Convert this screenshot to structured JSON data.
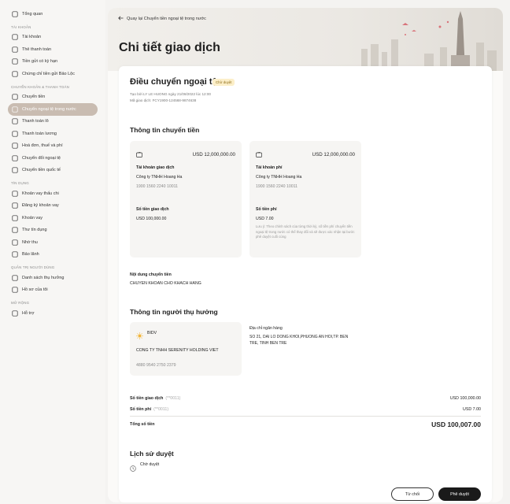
{
  "sidebar": {
    "top": [
      {
        "label": "Tổng quan",
        "icon": "dashboard-icon"
      }
    ],
    "groups": [
      {
        "heading": "TÀI KHOẢN",
        "items": [
          {
            "label": "Tài khoản",
            "icon": "bank-icon"
          },
          {
            "label": "Thẻ thanh toán",
            "icon": "card-icon"
          },
          {
            "label": "Tiền gửi có kỳ hạn",
            "icon": "deposit-icon"
          },
          {
            "label": "Chứng chỉ tiền gửi Bảo Lộc",
            "icon": "certificate-icon"
          }
        ]
      },
      {
        "heading": "CHUYỂN KHOẢN & THANH TOÁN",
        "items": [
          {
            "label": "Chuyển tiền",
            "icon": "transfer-icon"
          },
          {
            "label": "Chuyển ngoại tệ trong nước",
            "icon": "foreign-transfer-icon",
            "active": true
          },
          {
            "label": "Thanh toán lô",
            "icon": "batch-icon"
          },
          {
            "label": "Thanh toán lương",
            "icon": "payroll-icon"
          },
          {
            "label": "Hoá đơn, thuế và phí",
            "icon": "bill-icon"
          },
          {
            "label": "Chuyển đổi ngoại tệ",
            "icon": "exchange-icon"
          },
          {
            "label": "Chuyển tiền quốc tế",
            "icon": "globe-icon"
          }
        ]
      },
      {
        "heading": "TÍN DỤNG",
        "items": [
          {
            "label": "Khoản vay thấu chi",
            "icon": "overdraft-icon"
          },
          {
            "label": "Đăng ký khoản vay",
            "icon": "loan-register-icon"
          },
          {
            "label": "Khoản vay",
            "icon": "loan-icon"
          },
          {
            "label": "Thư tín dụng",
            "icon": "letter-credit-icon"
          },
          {
            "label": "Nhờ thu",
            "icon": "collection-icon"
          },
          {
            "label": "Bảo lãnh",
            "icon": "guarantee-icon"
          }
        ]
      },
      {
        "heading": "QUẢN TRỊ NGƯỜI DÙNG",
        "items": [
          {
            "label": "Danh sách thụ hưởng",
            "icon": "beneficiary-icon"
          },
          {
            "label": "Hồ sơ của tôi",
            "icon": "profile-icon"
          }
        ]
      },
      {
        "heading": "MỞ RỘNG",
        "items": [
          {
            "label": "Hỗ trợ",
            "icon": "help-icon"
          }
        ]
      }
    ]
  },
  "header": {
    "back_label": "Quay lại Chuyển tiền ngoại tệ trong nước",
    "page_title": "Chi tiết giao dịch"
  },
  "transaction": {
    "title": "Điều chuyển ngoại tệ",
    "status": "Chờ duyệt",
    "created_by": "Tạo bởi LY LE HUONG ngày 21/08/2022 lúc 12:00",
    "transaction_code": "Mã giao dịch: FCY1900-124568-9874638"
  },
  "transfer_info": {
    "heading": "Thông tin chuyển tiền",
    "source": {
      "balance": "USD 12,000,000.00",
      "account_label": "Tài khoản giao dịch",
      "company": "Công ty TNHH Hoang Ha",
      "account_number": "1900 1560 2240 10011",
      "amount_label": "Số tiền giao dịch",
      "amount": "USD 100,000.00"
    },
    "fee": {
      "balance": "USD 12,000,000.00",
      "account_label": "Tài khoản phí",
      "company": "Công ty TNHH Hoang Ha",
      "account_number": "1900 1560 2240 10011",
      "amount_label": "Số tiền phí",
      "amount": "USD 7.00",
      "note": "Lưu ý: Theo chính sách của từng thời kỳ, số tiền phí chuyển tiền ngoại tệ trong nước có thể thay đổi và sẽ được xác nhận tại bước phê duyệt cuối cùng"
    },
    "content_label": "Nội dung chuyển tiền",
    "content_value": "CHUYEN KHOAN CHO KHACH HANG"
  },
  "beneficiary": {
    "heading": "Thông tin người thụ hưởng",
    "bank_name": "BIDV",
    "name": "CONG TY TNHH SERENITY HOLDING VIET",
    "account_number": "4880 9540 2750 2379",
    "address_label": "Địa chỉ ngân hàng",
    "address": "SO 21, DAI LO DONG KHOI,PHUONG AN HOI,TP. BEN TRE, TINH BEN TRE"
  },
  "summary": {
    "tx_label": "Số tiền giao dịch",
    "tx_suffix": "(**0011)",
    "tx_value": "USD 100,000.00",
    "fee_label": "Số tiền phí",
    "fee_suffix": "(**0011)",
    "fee_value": "USD 7.00",
    "total_label": "Tổng số tiền",
    "total_value": "USD 100,007.00"
  },
  "history": {
    "heading": "Lịch sử duyệt",
    "status": "Chờ duyệt"
  },
  "actions": {
    "reject": "Từ chối",
    "approve": "Phê duyệt"
  },
  "colors": {
    "active_nav": "#c9bcb1",
    "badge_bg": "#fcefc9",
    "bidv_icon": "#f2b53a",
    "approve_btn": "#1a1a1a"
  }
}
